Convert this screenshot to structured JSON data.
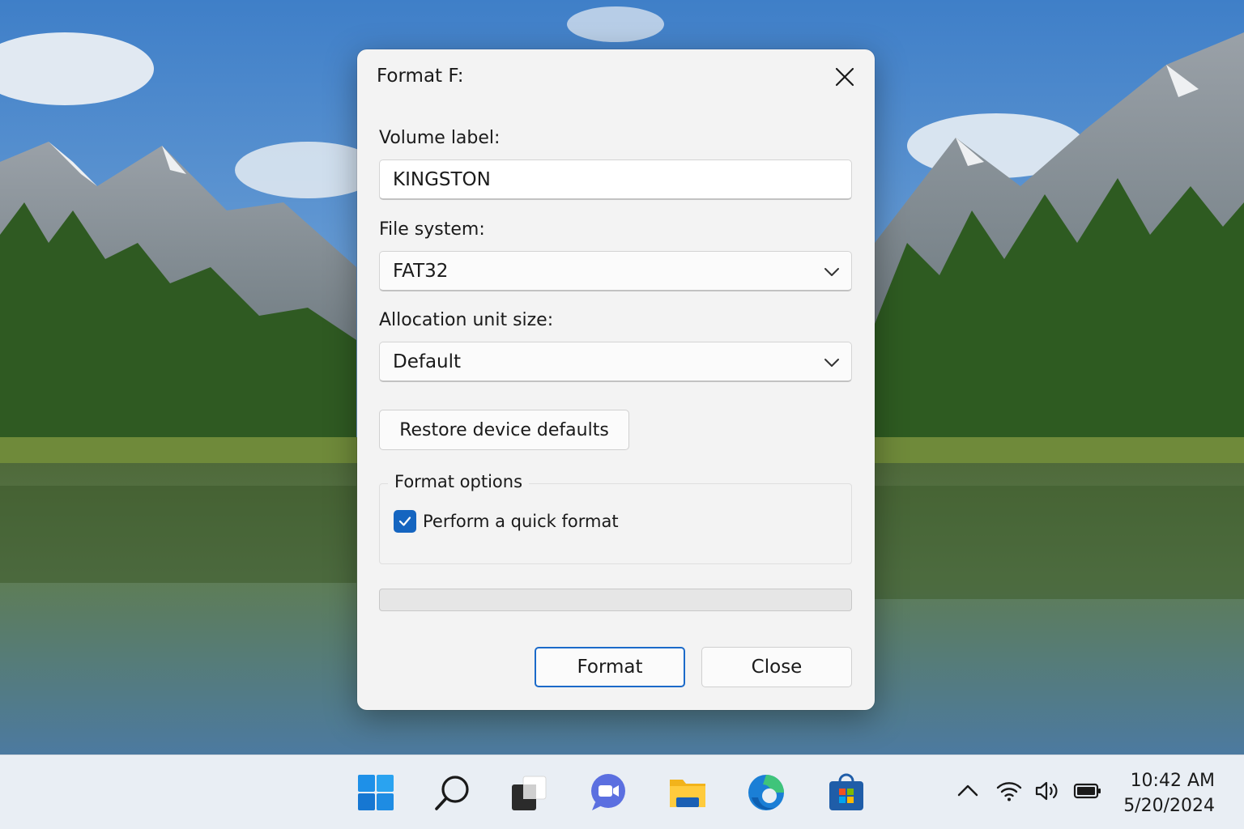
{
  "dialog": {
    "title": "Format F:",
    "volume_label": {
      "label": "Volume label:",
      "value": "KINGSTON"
    },
    "file_system": {
      "label": "File system:",
      "selected": "FAT32"
    },
    "allocation_unit_size": {
      "label": "Allocation unit size:",
      "selected": "Default"
    },
    "restore_button": "Restore device defaults",
    "format_options": {
      "legend": "Format options",
      "quick_format": {
        "label": "Perform a quick format",
        "checked": true
      }
    },
    "progress": {
      "fraction": 0.0
    },
    "format_button": "Format",
    "close_button": "Close"
  },
  "taskbar": {
    "icons": [
      "start-icon",
      "search-icon",
      "task-view-icon",
      "chat-icon",
      "file-explorer-icon",
      "edge-icon",
      "store-icon"
    ],
    "tray": [
      "chevron-up-icon",
      "wifi-icon",
      "volume-icon",
      "battery-icon"
    ],
    "clock": {
      "time": "10:42 AM",
      "date": "5/20/2024"
    }
  },
  "colors": {
    "accent": "#1565c0",
    "dialog_bg": "#f3f3f3",
    "taskbar_bg": "#e9eef4"
  }
}
